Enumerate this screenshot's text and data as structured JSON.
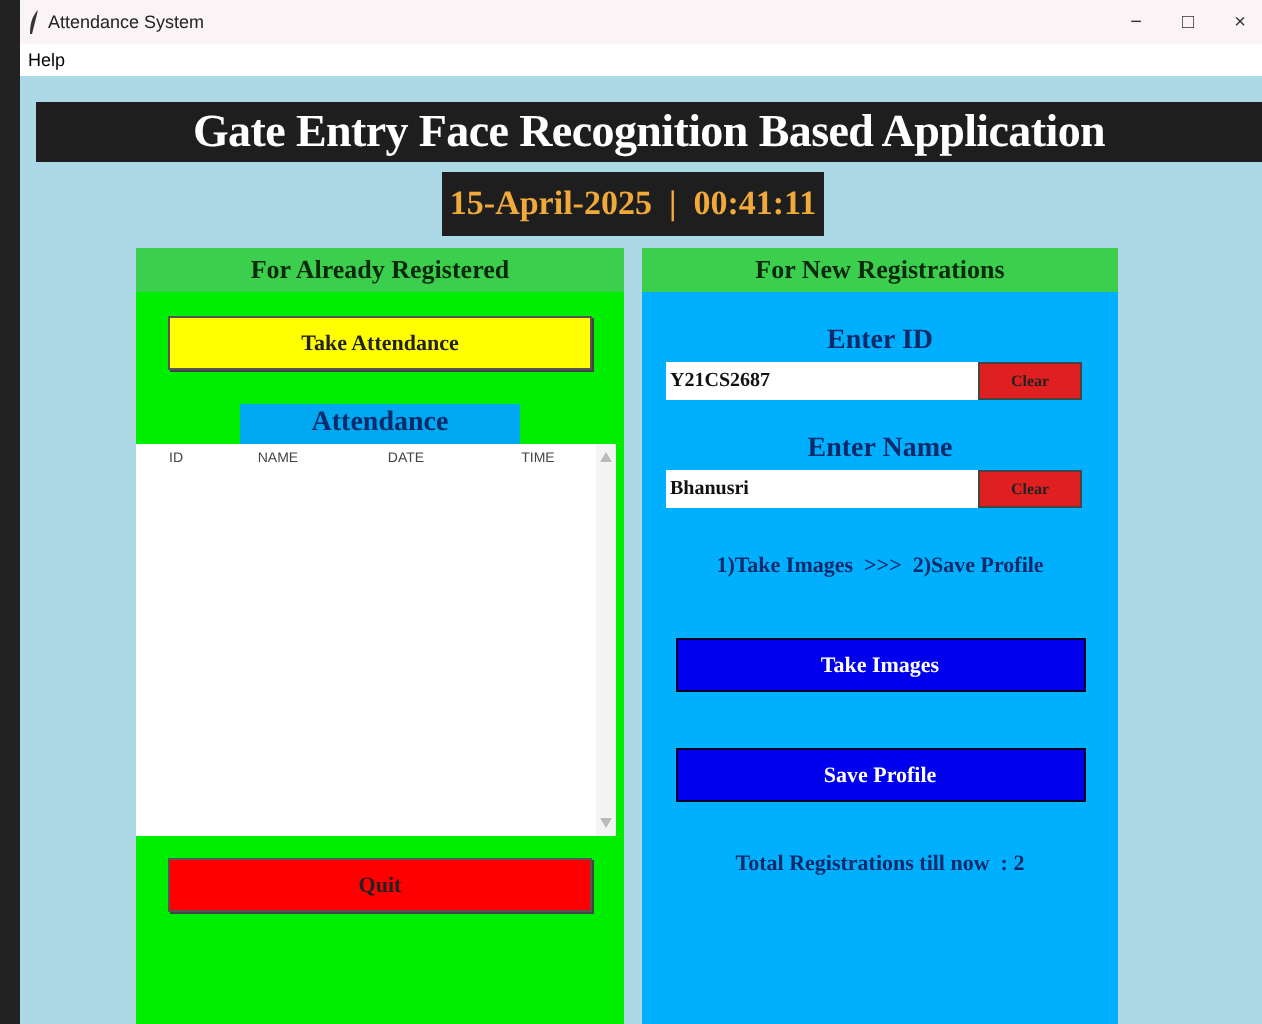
{
  "window": {
    "title": "Attendance System",
    "controls": [
      "−",
      "□",
      "×"
    ]
  },
  "menu": [
    "Help"
  ],
  "header": {
    "title": "Gate Entry Face Recognition Based Application",
    "datetime": "15-April-2025  |  00:41:11"
  },
  "registered_panel": {
    "title": "For Already Registered",
    "take_attendance_button": "Take Attendance",
    "attendance_label": "Attendance",
    "table": {
      "columns": [
        "ID",
        "NAME",
        "DATE",
        "TIME"
      ]
    },
    "quit_button": "Quit"
  },
  "new_panel": {
    "title": "For New Registrations",
    "fields": [
      {
        "label": "Enter ID",
        "value": "Y21CS2687",
        "clear_button": "Clear"
      },
      {
        "label": "Enter Name",
        "value": "Bhanusri",
        "clear_button": "Clear"
      }
    ],
    "steps": "1)Take Images  >>>  2)Save Profile",
    "take_images_button": "Take Images",
    "save_profile_button": "Save Profile",
    "total": "Total Registrations till now  : 2"
  }
}
